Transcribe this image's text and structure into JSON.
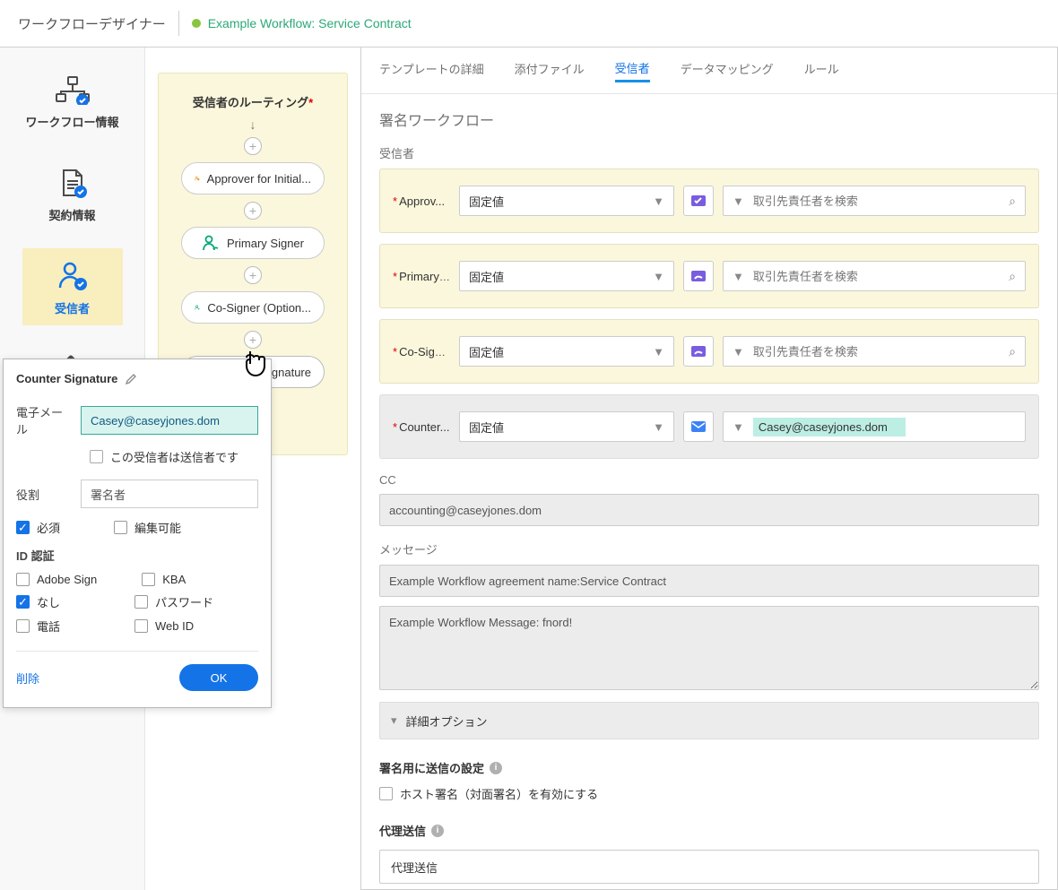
{
  "topbar": {
    "title": "ワークフローデザイナー",
    "workflow_name": "Example Workflow: Service Contract"
  },
  "left_nav": {
    "items": [
      {
        "label": "ワークフロー情報"
      },
      {
        "label": "契約情報"
      },
      {
        "label": "受信者"
      },
      {
        "label": ""
      }
    ]
  },
  "canvas": {
    "title": "受信者のルーティング",
    "nodes": [
      {
        "label": "Approver for Initial..."
      },
      {
        "label": "Primary Signer"
      },
      {
        "label": "Co-Signer (Option..."
      },
      {
        "label": "Counter Signature"
      }
    ]
  },
  "tabs": [
    {
      "label": "テンプレートの詳細"
    },
    {
      "label": "添付ファイル"
    },
    {
      "label": "受信者",
      "active": true
    },
    {
      "label": "データマッピング"
    },
    {
      "label": "ルール"
    }
  ],
  "panel": {
    "section_title": "署名ワークフロー",
    "recipients_title": "受信者",
    "dropdown_value": "固定値",
    "search_placeholder": "取引先責任者を検索",
    "rows": [
      {
        "label": "Approv..."
      },
      {
        "label": "Primary ..."
      },
      {
        "label": "Co-Sign..."
      }
    ],
    "counter": {
      "label": "Counter...",
      "email": "Casey@caseyjones.dom"
    },
    "cc": {
      "title": "CC",
      "value": "accounting@caseyjones.dom"
    },
    "message": {
      "title": "メッセージ",
      "subject": "Example Workflow agreement name:Service Contract",
      "body": "Example Workflow Message: fnord!"
    },
    "accordion": "詳細オプション",
    "send_settings": "署名用に送信の設定",
    "host_sign": "ホスト署名（対面署名）を有効にする",
    "proxy_title": "代理送信",
    "proxy_placeholder": "代理送信"
  },
  "popup": {
    "title": "Counter Signature",
    "email_label": "電子メール",
    "email_value": "Casey@caseyjones.dom",
    "sender_cb": "この受信者は送信者です",
    "role_label": "役割",
    "role_value": "署名者",
    "required": "必須",
    "editable": "編集可能",
    "id_auth": "ID 認証",
    "auth_opts": [
      {
        "l": "Adobe Sign"
      },
      {
        "l": "KBA"
      },
      {
        "l": "なし",
        "c": true
      },
      {
        "l": "パスワード"
      },
      {
        "l": "電話"
      },
      {
        "l": "Web ID"
      }
    ],
    "delete": "削除",
    "ok": "OK"
  }
}
